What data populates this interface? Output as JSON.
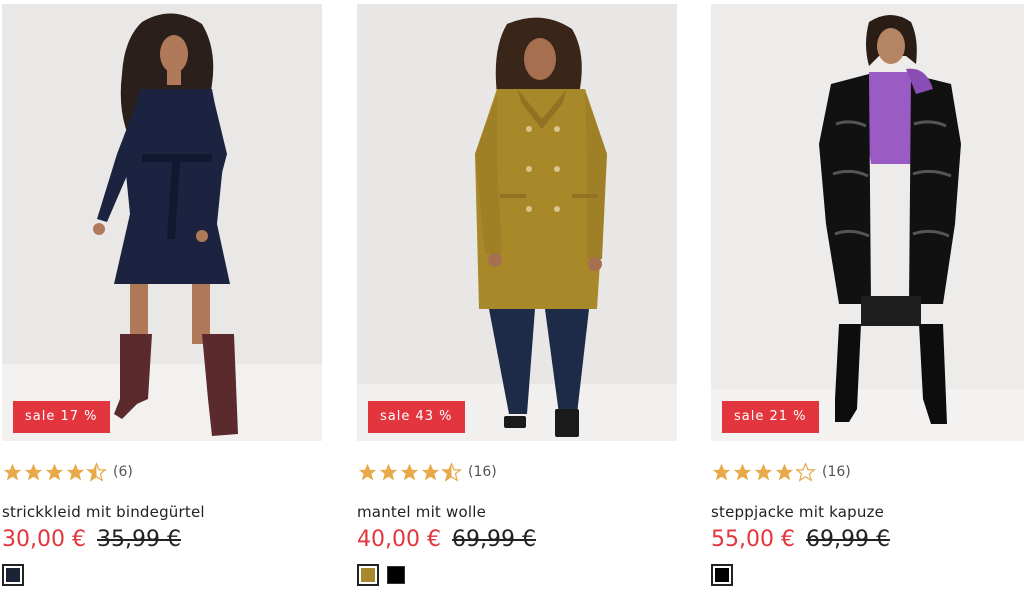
{
  "products": [
    {
      "badge": "sale 17 %",
      "rating": 4.5,
      "rating_count": "(6)",
      "name": "strickkleid mit bindegürtel",
      "price_now": "30,00 €",
      "price_old": "35,99 €",
      "image_label": "model wearing navy knit wrap dress with tie belt and burgundy boots",
      "swatches": [
        {
          "color": "#1b2233",
          "selected": true
        }
      ]
    },
    {
      "badge": "sale 43 %",
      "rating": 4.5,
      "rating_count": "(16)",
      "name": "mantel mit wolle",
      "price_now": "40,00 €",
      "price_old": "69,99 €",
      "image_label": "model wearing mustard double-breasted wool coat with jeans",
      "swatches": [
        {
          "color": "#a8882e",
          "selected": true
        },
        {
          "color": "#000000",
          "selected": false
        }
      ]
    },
    {
      "badge": "sale 21 %",
      "rating": 4,
      "rating_count": "(16)",
      "name": "steppjacke mit kapuze",
      "price_now": "55,00 €",
      "price_old": "69,99 €",
      "image_label": "model wearing long black glossy puffer jacket with purple lining",
      "swatches": [
        {
          "color": "#000000",
          "selected": true
        }
      ]
    }
  ],
  "colors": {
    "sale_red": "#e3353d",
    "star_gold": "#e7a94a",
    "text_dark": "#222222"
  }
}
